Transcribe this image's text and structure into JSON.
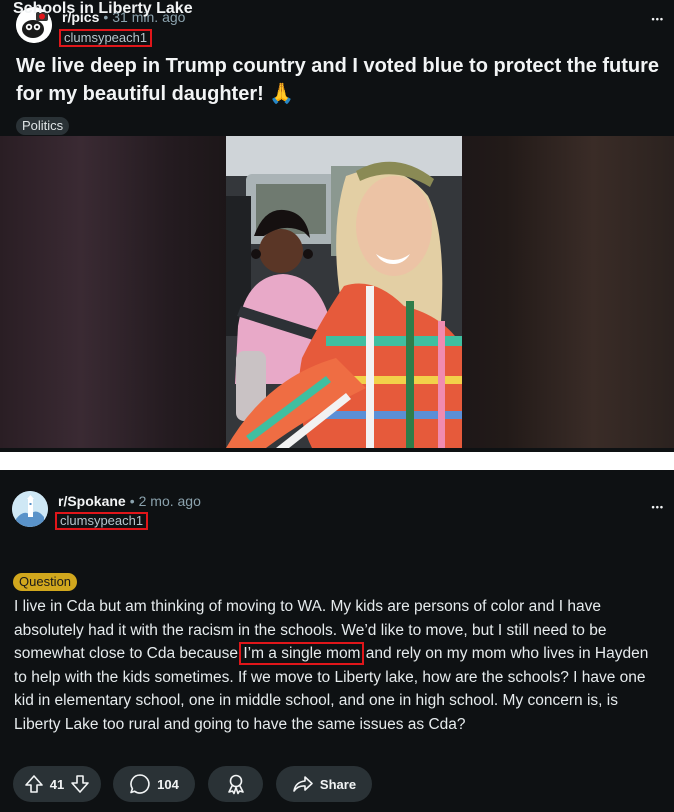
{
  "post1": {
    "subreddit": "r/pics",
    "separator": "•",
    "time": "31 min. ago",
    "username": "clumsypeach1",
    "more": "•••",
    "title": "We live deep in Trump country and I voted blue to protect the future for my beautiful daughter! 🙏",
    "flair": "Politics"
  },
  "post2": {
    "subreddit": "r/Spokane",
    "separator": "•",
    "time": "2 mo. ago",
    "username": "clumsypeach1",
    "more": "•••",
    "title": "Schools in Liberty Lake",
    "flair": "Question",
    "body_before": "I live in Cda but am thinking of moving to WA. My kids are persons of color and I have absolutely had it with the racism in the schools. We’d like to move, but I still need to be somewhat close to Cda because ",
    "body_highlight": "I’m a single mom",
    "body_after": " and rely on my mom who lives in Hayden to help with the kids sometimes. If we move to Liberty lake, how are the schools? I have one kid in elementary school, one in middle school, and one in high school. My concern is, is Liberty Lake too rural and going to have the same issues as Cda?",
    "actions": {
      "votes": "41",
      "comments": "104",
      "share": "Share"
    }
  },
  "colors": {
    "background": "#0e1113",
    "highlight_box": "#e0161a",
    "question_flair": "#d1a71d",
    "pill": "#2a3236"
  }
}
